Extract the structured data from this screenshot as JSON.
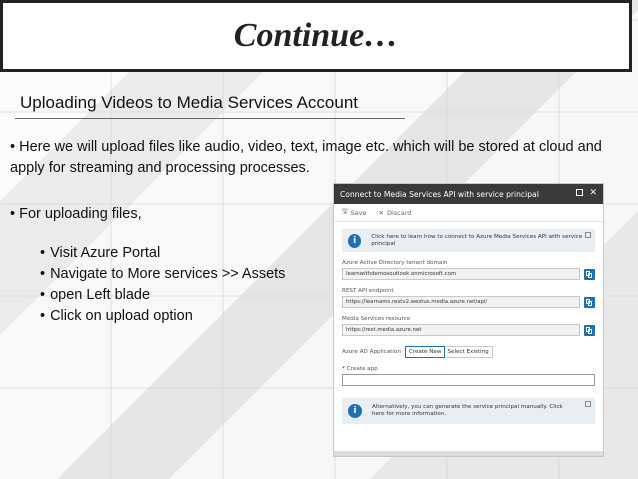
{
  "slide": {
    "title": "Continue…",
    "subtitle": "Uploading Videos to Media Services Account",
    "paragraph1": "• Here we will upload files like audio, video, text, image etc. which will be stored at cloud and apply for streaming and processing processes.",
    "paragraph2": "• For uploading files,",
    "steps": [
      "Visit Azure Portal",
      "Navigate to More services >> Assets",
      "open Left blade",
      "Click on upload option"
    ]
  },
  "dialog": {
    "title": "Connect to Media Services API with service principal",
    "toolbar": {
      "save_label": "Save",
      "discard_label": "Discard"
    },
    "info_text": "Click here to learn how to connect to Azure Media Services API with service principal",
    "fields": [
      {
        "label": "Azure Active Directory tenant domain",
        "value": "learnwithdemosoutlook.onmicrosoft.com"
      },
      {
        "label": "REST API endpoint",
        "value": "https://learnams.restv2.westus.media.azure.net/api/"
      },
      {
        "label": "Media Services resource",
        "value": "https://rest.media.azure.net"
      }
    ],
    "app_label": "Azure AD Application",
    "app_options": [
      "Create New",
      "Select Existing"
    ],
    "create_label": "Create app",
    "alt_text": "Alternatively, you can generate the service principal manually. Click here for more information."
  },
  "colors": {
    "accent": "#1f6fb3",
    "header": "#3a3a3a"
  },
  "icons": [
    "info-icon",
    "copy-icon",
    "save-icon",
    "discard-icon",
    "external-link-icon",
    "maximize-icon",
    "close-icon"
  ]
}
